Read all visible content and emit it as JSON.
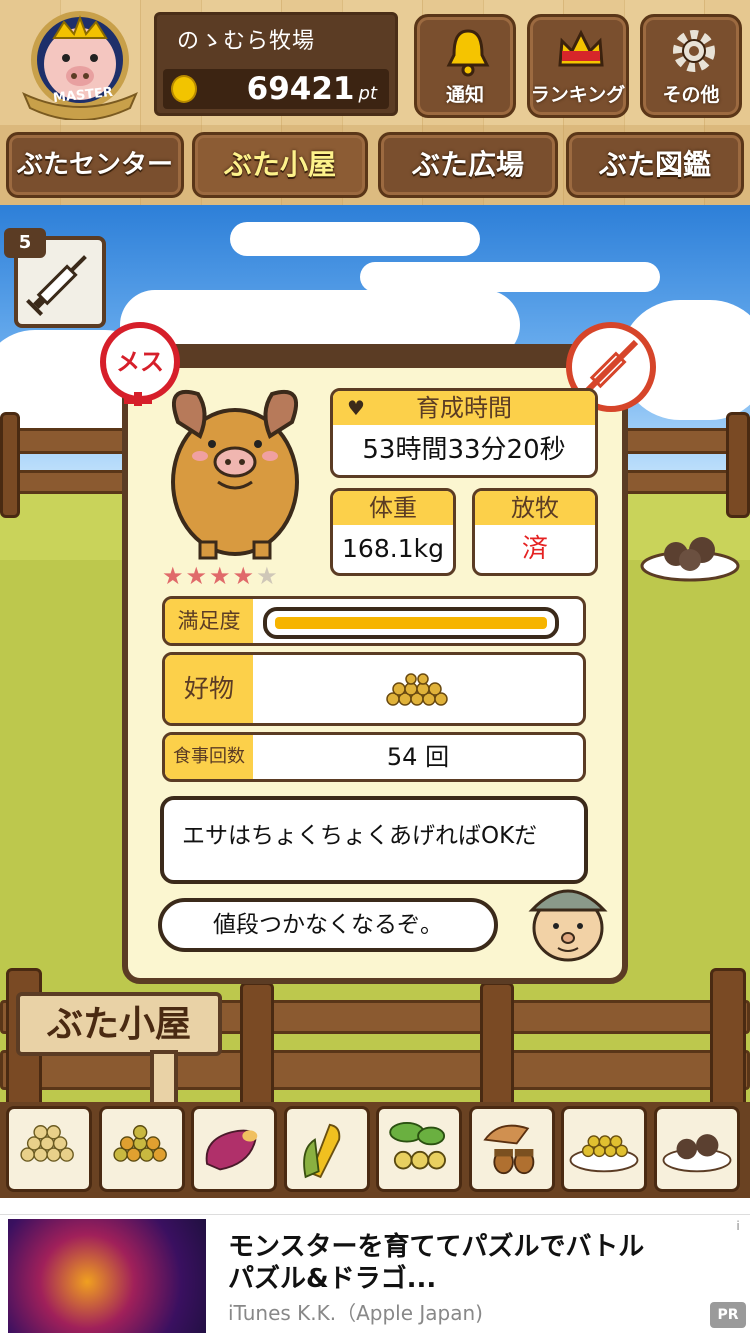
{
  "header": {
    "badge_label": "MASTER",
    "farm_name": "のゝむら牧場",
    "points_value": "69421",
    "points_unit": "pt",
    "buttons": [
      {
        "label": "通知",
        "icon": "bell-icon"
      },
      {
        "label": "ランキング",
        "icon": "crown-icon"
      },
      {
        "label": "その他",
        "icon": "gear-icon"
      }
    ]
  },
  "tabs": [
    {
      "label": "ぶたセンター",
      "active": false
    },
    {
      "label": "ぶた小屋",
      "active": true
    },
    {
      "label": "ぶた広場",
      "active": false
    },
    {
      "label": "ぶた図鑑",
      "active": false
    }
  ],
  "syringe": {
    "count": "5",
    "icon": "syringe-icon"
  },
  "pig": {
    "gender_label": "メス",
    "rating": 4,
    "rating_max": 5,
    "raising_time_label": "育成時間",
    "raising_time": "53時間33分20秒",
    "weight_label": "体重",
    "weight": "168.1kg",
    "pasture_label": "放牧",
    "pasture_value": "済",
    "satisfaction_label": "満足度",
    "satisfaction": 0.97,
    "favorite_label": "好物",
    "favorite_icon": "grain-pile-icon",
    "meals_label": "食事回数",
    "meals_value": "54 回"
  },
  "dialog": {
    "line1": "エサはちょくちょくあげればOKだ",
    "line2": "値段つかなくなるぞ。"
  },
  "scene": {
    "sign_label": "ぶた小屋"
  },
  "foods": [
    {
      "icon": "soybean-pile-icon"
    },
    {
      "icon": "mixed-beans-icon"
    },
    {
      "icon": "sweet-potato-icon"
    },
    {
      "icon": "corn-icon"
    },
    {
      "icon": "vegetable-icon"
    },
    {
      "icon": "acorn-icon"
    },
    {
      "icon": "bean-plate-icon"
    },
    {
      "icon": "meatball-plate-icon"
    }
  ],
  "ad": {
    "title": "モンスターを育ててパズルでバトル パズル&ドラゴ...",
    "publisher": "iTunes K.K.（Apple Japan)",
    "info_icon": "i",
    "pr_label": "PR"
  },
  "colors": {
    "accent": "#fcd04a",
    "wood": "#7a4f2e",
    "female": "#d61f2a",
    "pasture_value": "#e52222"
  }
}
